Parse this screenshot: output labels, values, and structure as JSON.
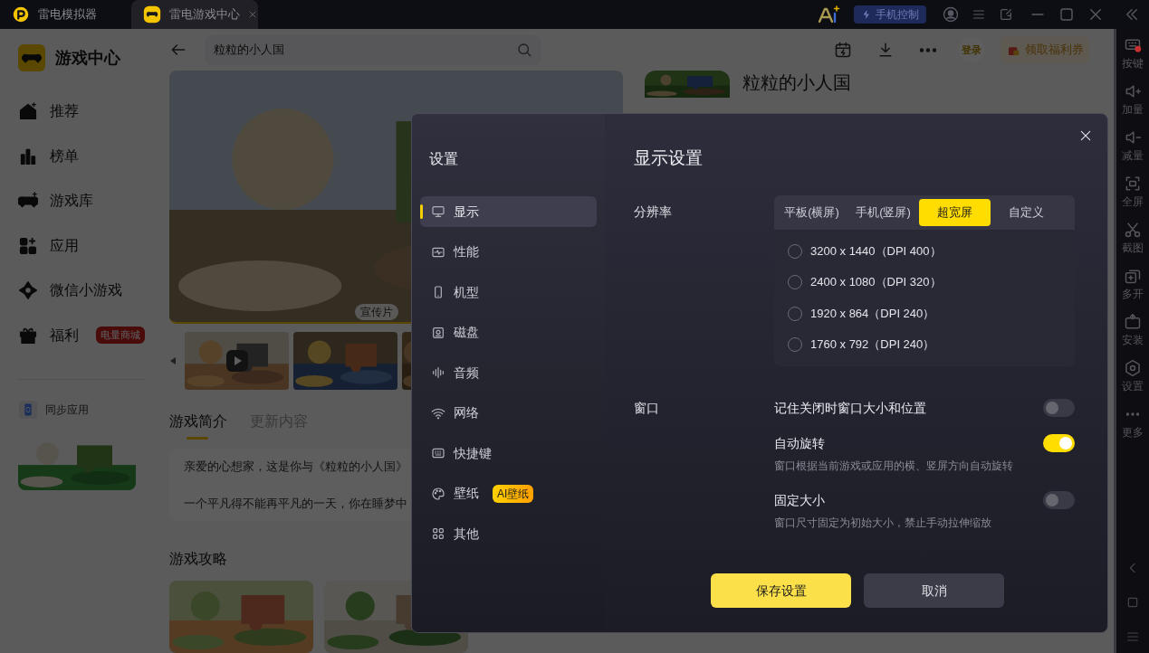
{
  "title_bar": {
    "tabs": [
      {
        "label": "雷电模拟器",
        "selected": false
      },
      {
        "label": "雷电游戏中心",
        "selected": true
      }
    ],
    "phone_control": "手机控制"
  },
  "app": {
    "title": "游戏中心",
    "search": {
      "value": "粒粒的小人国"
    },
    "login": "登录",
    "coupon": "领取福利券"
  },
  "nav": [
    {
      "label": "推荐"
    },
    {
      "label": "榜单"
    },
    {
      "label": "游戏库"
    },
    {
      "label": "应用"
    },
    {
      "label": "微信小游戏"
    },
    {
      "label": "福利",
      "badge": "电量商城"
    }
  ],
  "sync": "同步应用",
  "game": {
    "title": "粒粒的小人国",
    "video_badge": "宣传片",
    "tabs": [
      {
        "label": "游戏简介",
        "selected": true
      },
      {
        "label": "更新内容",
        "selected": false
      }
    ],
    "description": [
      "亲爱的心想家，这是你与《粒粒的小人国》",
      "一个平凡得不能再平凡的一天，你在睡梦中"
    ],
    "guides_heading": "游戏攻略"
  },
  "settings": {
    "title": "设置",
    "menu": [
      {
        "label": "显示",
        "selected": true
      },
      {
        "label": "性能",
        "selected": false
      },
      {
        "label": "机型",
        "selected": false
      },
      {
        "label": "磁盘",
        "selected": false
      },
      {
        "label": "音频",
        "selected": false
      },
      {
        "label": "网络",
        "selected": false
      },
      {
        "label": "快捷键",
        "selected": false
      },
      {
        "label": "壁纸",
        "selected": false,
        "badge": "AI壁纸"
      },
      {
        "label": "其他",
        "selected": false
      }
    ],
    "heading": "显示设置",
    "resolution": {
      "label": "分辨率",
      "presets": [
        {
          "label": "平板(横屏)",
          "selected": false
        },
        {
          "label": "手机(竖屏)",
          "selected": false
        },
        {
          "label": "超宽屏",
          "selected": true
        },
        {
          "label": "自定义",
          "selected": false
        }
      ],
      "options": [
        {
          "label": "3200 x 1440（DPI 400）",
          "selected": false
        },
        {
          "label": "2400 x 1080（DPI 320）",
          "selected": false
        },
        {
          "label": "1920 x 864（DPI 240）",
          "selected": false
        },
        {
          "label": "1760 x 792（DPI 240）",
          "selected": false
        }
      ]
    },
    "window": {
      "label": "窗口",
      "toggles": [
        {
          "label": "记住关闭时窗口大小和位置",
          "on": false
        },
        {
          "label": "自动旋转",
          "description": "窗口根据当前游戏或应用的横、竖屏方向自动旋转",
          "on": true
        },
        {
          "label": "固定大小",
          "description": "窗口尺寸固定为初始大小，禁止手动拉伸缩放",
          "on": false
        }
      ]
    },
    "buttons": [
      {
        "label": "保存设置",
        "kind": "primary"
      },
      {
        "label": "取消",
        "kind": "secondary"
      }
    ]
  },
  "side_toolbar": [
    {
      "label": "按键"
    },
    {
      "label": "加量"
    },
    {
      "label": "减量"
    },
    {
      "label": "全屏"
    },
    {
      "label": "截图"
    },
    {
      "label": "多开"
    },
    {
      "label": "安装"
    },
    {
      "label": "设置"
    },
    {
      "label": "更多"
    }
  ]
}
